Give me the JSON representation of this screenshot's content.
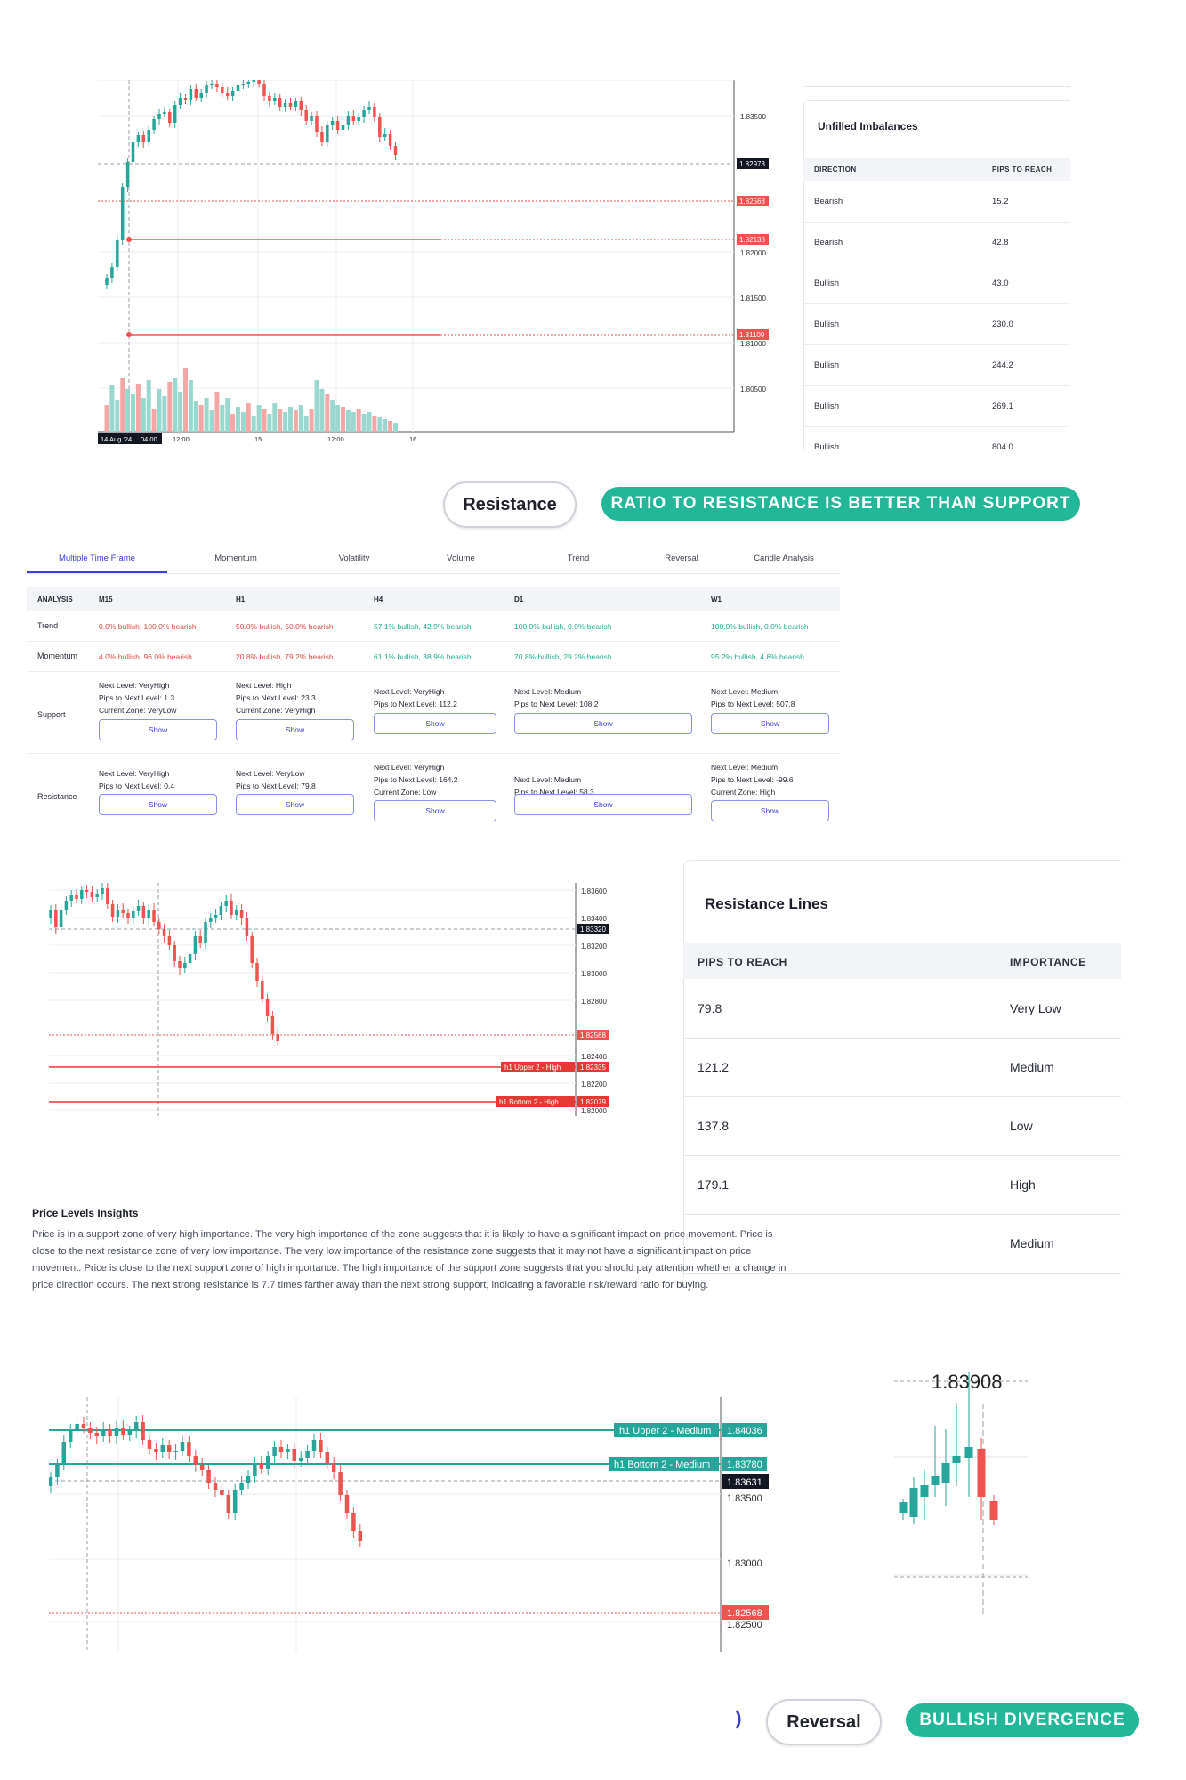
{
  "chart1": {
    "price_labels": [
      "1.83500",
      "1.82000",
      "1.81500",
      "1.81000",
      "1.80500"
    ],
    "markers": {
      "current": "1.82973",
      "red_top": "1.82568",
      "red_mid": "1.82138",
      "red_low": "1.81109"
    },
    "time_labels": [
      "14 Aug '24",
      "04:00",
      "12:00",
      "15",
      "12:00",
      "16"
    ]
  },
  "imbalances": {
    "title": "Unfilled Imbalances",
    "headers": [
      "DIRECTION",
      "PIPS TO REACH"
    ],
    "rows": [
      {
        "direction": "Bearish",
        "pips": "15.2"
      },
      {
        "direction": "Bearish",
        "pips": "42.8"
      },
      {
        "direction": "Bullish",
        "pips": "43.0"
      },
      {
        "direction": "Bullish",
        "pips": "230.0"
      },
      {
        "direction": "Bullish",
        "pips": "244.2"
      },
      {
        "direction": "Bullish",
        "pips": "269.1"
      },
      {
        "direction": "Bullish",
        "pips": "804.0"
      }
    ]
  },
  "pill1": {
    "label": "Resistance",
    "badge": "RATIO TO RESISTANCE IS BETTER THAN SUPPORT"
  },
  "tabs": [
    "Multiple Time Frame",
    "Momentum",
    "Volatility",
    "Volume",
    "Trend",
    "Reversal",
    "Candle Analysis"
  ],
  "analysis": {
    "headers": [
      "ANALYSIS",
      "M15",
      "H1",
      "H4",
      "D1",
      "W1"
    ],
    "trend": {
      "label": "Trend",
      "values": [
        "0.0% bullish, 100.0% bearish",
        "50.0% bullish, 50.0% bearish",
        "57.1% bullish, 42.9% bearish",
        "100.0% bullish, 0.0% bearish",
        "100.0% bullish, 0.0% bearish"
      ]
    },
    "momentum": {
      "label": "Momentum",
      "values": [
        "4.0% bullish, 96.0% bearish",
        "20.8% bullish, 79.2% bearish",
        "61.1% bullish, 38.9% bearish",
        "70.8% bullish, 29.2% bearish",
        "95.2% bullish, 4.8% bearish"
      ]
    },
    "support": {
      "label": "Support",
      "cells": [
        [
          "Next Level: VeryHigh",
          "Pips to Next Level: 1.3",
          "Current Zone: VeryLow"
        ],
        [
          "Next Level: High",
          "Pips to Next Level: 23.3",
          "Current Zone: VeryHigh"
        ],
        [
          "Next Level: VeryHigh",
          "Pips to Next Level: 112.2"
        ],
        [
          "Next Level: Medium",
          "Pips to Next Level: 108.2"
        ],
        [
          "Next Level: Medium",
          "Pips to Next Level: 507.8"
        ]
      ]
    },
    "resistance": {
      "label": "Resistance",
      "cells": [
        [
          "Next Level: VeryHigh",
          "Pips to Next Level: 0.4"
        ],
        [
          "Next Level: VeryLow",
          "Pips to Next Level: 79.8"
        ],
        [
          "Next Level: VeryHigh",
          "Pips to Next Level: 164.2",
          "Current Zone: Low"
        ],
        [
          "Next Level: Medium",
          "Pips to Next Level: 58.3"
        ],
        [
          "Next Level: Medium",
          "Pips to Next Level: -99.6",
          "Current Zone: High"
        ]
      ]
    },
    "show_label": "Show"
  },
  "chart2": {
    "price_labels": [
      "1.83600",
      "1.83400",
      "1.83200",
      "1.83000",
      "1.82800",
      "1.82400",
      "1.82200",
      "1.82000"
    ],
    "current": "1.83320",
    "red": "1.82568",
    "upper_line": {
      "tag": "h1 Upper 2 - High",
      "value": "1.82335"
    },
    "bottom_line": {
      "tag": "h1 Bottom 2 - High",
      "value": "1.82079"
    }
  },
  "resistance_lines": {
    "title": "Resistance Lines",
    "headers": [
      "PIPS TO REACH",
      "IMPORTANCE"
    ],
    "rows": [
      {
        "pips": "79.8",
        "importance": "Very Low"
      },
      {
        "pips": "121.2",
        "importance": "Medium"
      },
      {
        "pips": "137.8",
        "importance": "Low"
      },
      {
        "pips": "179.1",
        "importance": "High"
      },
      {
        "pips": "",
        "importance": "Medium"
      }
    ]
  },
  "insights": {
    "title": "Price Levels Insights",
    "text": "Price is in a support zone of very high importance. The very high importance of the zone suggests that it is likely to have a significant impact on price movement. Price is close to the next resistance zone of very low importance. The very low importance of the resistance zone suggests that it may not have a significant impact on price movement. Price is close to the next support zone of high importance. The high importance of the support zone suggests that you should pay attention whether a change in price direction occurs. The next strong resistance is 7.7 times farther away than the next strong support, indicating a favorable risk/reward ratio for buying."
  },
  "chart3": {
    "upper_line": {
      "tag": "h1 Upper 2 - Medium",
      "value": "1.84036"
    },
    "bottom_line": {
      "tag": "h1 Bottom 2 - Medium",
      "value": "1.83780"
    },
    "current": "1.83631",
    "price_labels": [
      "1.83500",
      "1.83000"
    ],
    "red": "1.82568",
    "bottom_cut": "1.82500"
  },
  "chart4": {
    "top_label": "1.83908"
  },
  "pill2": {
    "label": "Reversal",
    "badge": "BULLISH DIVERGENCE"
  },
  "colors": {
    "bull": "#26a69a",
    "bear": "#ef5350",
    "accent": "#3b3ed8",
    "badge": "#23b79a"
  }
}
